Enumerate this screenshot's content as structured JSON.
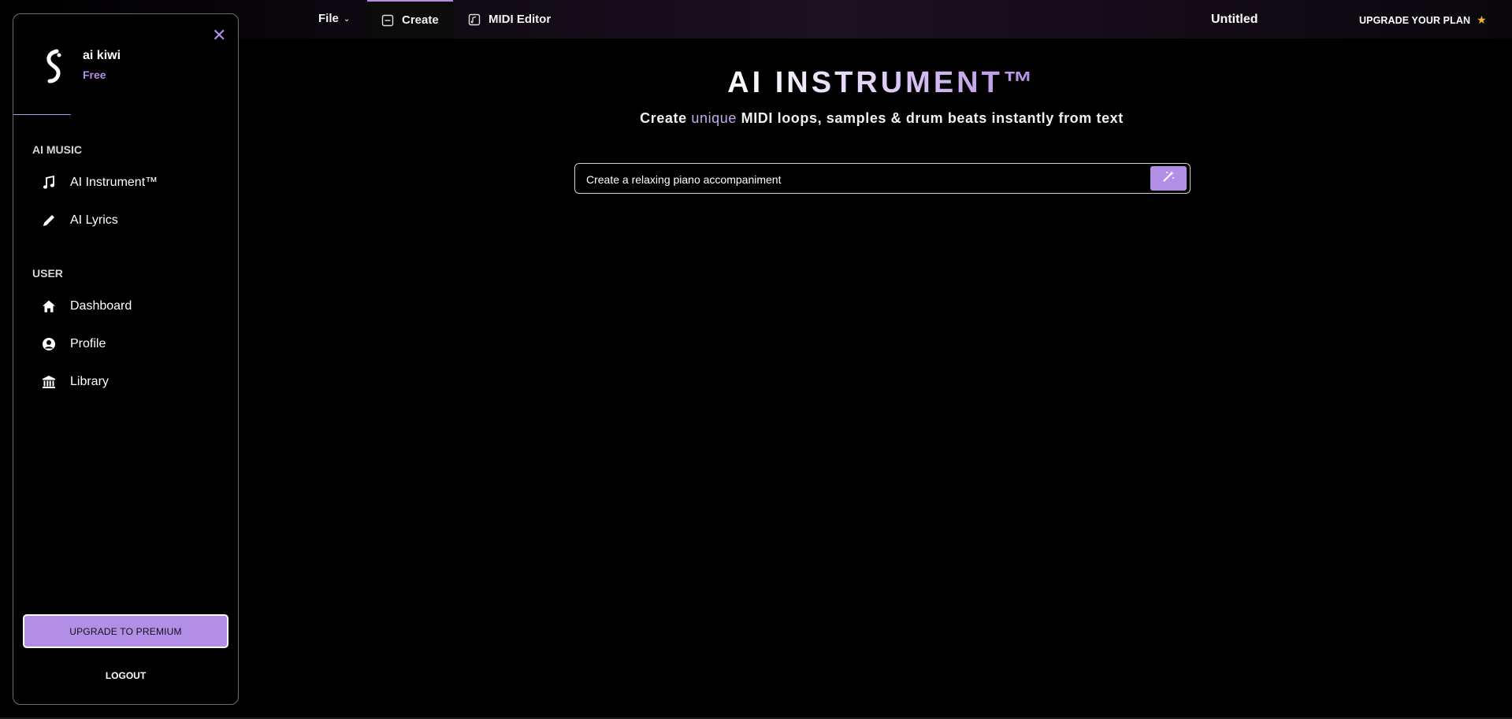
{
  "topbar": {
    "file_label": "File",
    "tabs": [
      {
        "label": "Create",
        "icon": "create-icon"
      },
      {
        "label": "MIDI Editor",
        "icon": "midi-editor-icon"
      }
    ],
    "doc_title": "Untitled",
    "upgrade_label": "UPGRADE YOUR PLAN",
    "upgrade_icon": "star-icon"
  },
  "sidebar": {
    "user": {
      "name": "ai kiwi",
      "plan": "Free"
    },
    "sections": [
      {
        "label": "AI MUSIC",
        "items": [
          {
            "label": "AI Instrument™",
            "icon": "music-note-icon"
          },
          {
            "label": "AI Lyrics",
            "icon": "pencil-icon"
          }
        ]
      },
      {
        "label": "USER",
        "items": [
          {
            "label": "Dashboard",
            "icon": "home-icon"
          },
          {
            "label": "Profile",
            "icon": "profile-icon"
          },
          {
            "label": "Library",
            "icon": "library-icon"
          }
        ]
      }
    ],
    "premium_button": "UPGRADE TO PREMIUM",
    "logout_button": "LOGOUT"
  },
  "main": {
    "title": "AI INSTRUMENT™",
    "subtitle_pre": "Create ",
    "subtitle_accent": "unique",
    "subtitle_post": " MIDI loops, samples & drum beats instantly from text",
    "prompt_value": "Create a relaxing piano accompaniment"
  },
  "colors": {
    "accent": "#b38ee6",
    "star": "#f1b62a",
    "background": "#000000"
  }
}
